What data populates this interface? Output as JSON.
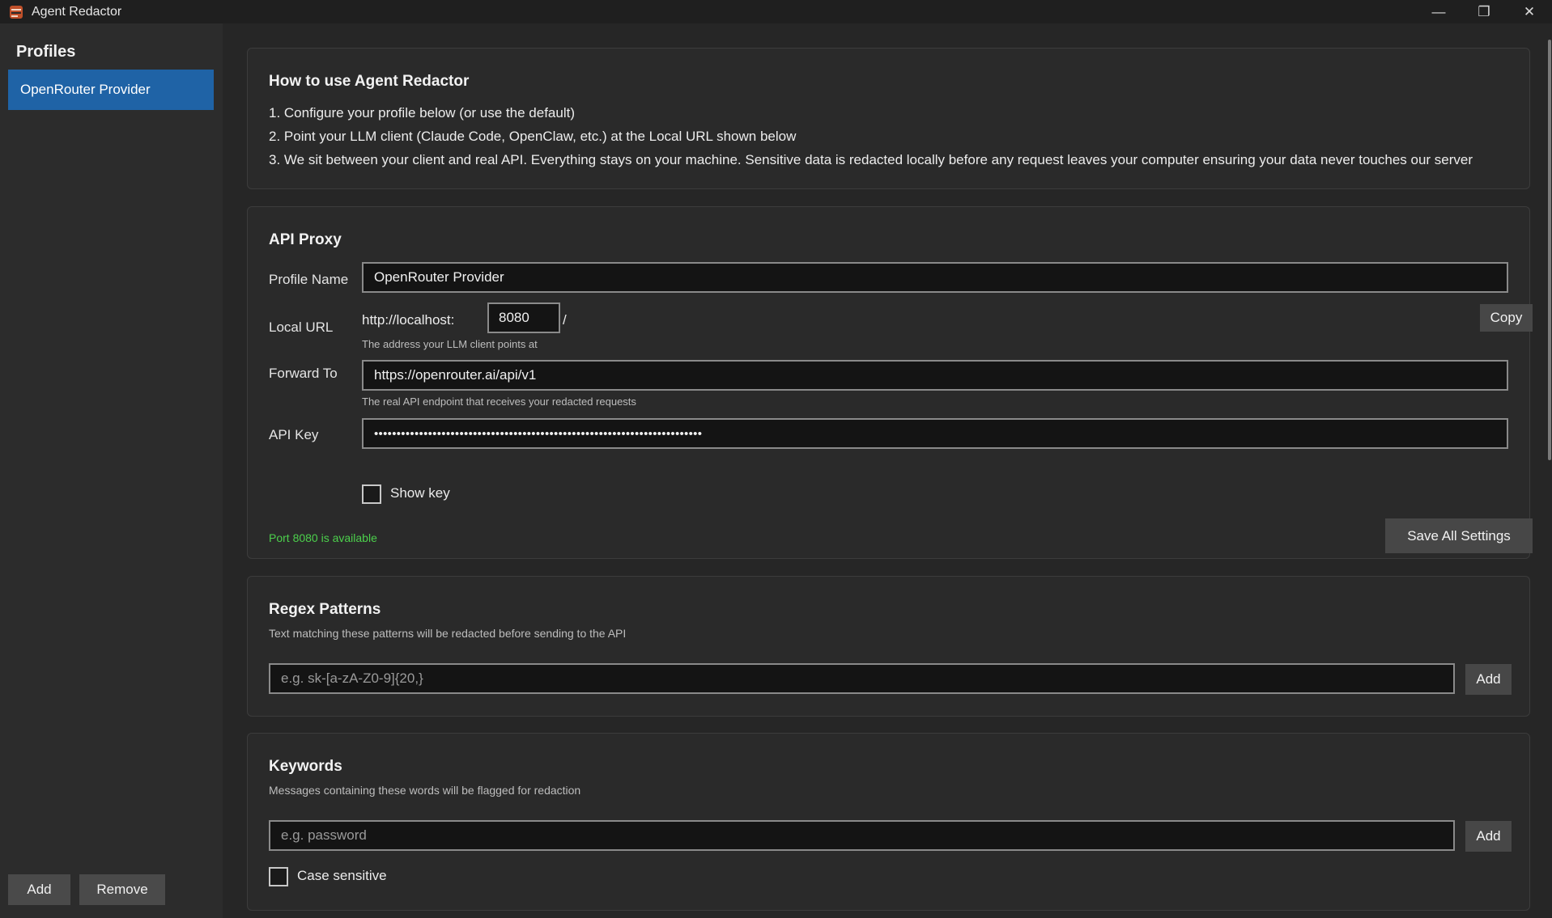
{
  "window": {
    "title": "Agent Redactor",
    "icon": "redactor-app-icon",
    "minimize_glyph": "—",
    "restore_glyph": "❐",
    "close_glyph": "✕"
  },
  "sidebar": {
    "title": "Profiles",
    "items": [
      {
        "label": "OpenRouter Provider",
        "selected": true
      }
    ],
    "add_label": "Add",
    "remove_label": "Remove"
  },
  "howto": {
    "title": "How to use Agent Redactor",
    "steps": [
      "1. Configure your profile below (or use the default)",
      "2. Point your LLM client (Claude Code, OpenClaw, etc.) at the Local URL shown below",
      "3. We sit between your client and real API. Everything stays on your machine. Sensitive data is redacted locally before any request leaves your computer ensuring your data never touches our server"
    ]
  },
  "proxy": {
    "title": "API Proxy",
    "profile_name_label": "Profile Name",
    "profile_name_value": "OpenRouter Provider",
    "local_url_label": "Local URL",
    "local_url_prefix": "http://localhost:",
    "port_value": "8080",
    "local_url_suffix": "/",
    "copy_label": "Copy",
    "local_url_hint": "The address your LLM client points at",
    "forward_label": "Forward To",
    "forward_value": "https://openrouter.ai/api/v1",
    "forward_hint": "The real API endpoint that receives your redacted requests",
    "api_key_label": "API Key",
    "api_key_masked": "•••••••••••••••••••••••••••••••••••••••••••••••••••••••••••••••••••••••••",
    "show_key_label": "Show key",
    "show_key_checked": false,
    "port_status": "Port 8080 is available",
    "save_label": "Save All Settings"
  },
  "regex": {
    "title": "Regex Patterns",
    "description": "Text matching these patterns will be redacted before sending to the API",
    "placeholder": "e.g. sk-[a-zA-Z0-9]{20,}",
    "add_label": "Add"
  },
  "keywords": {
    "title": "Keywords",
    "description": "Messages containing these words will be flagged for redaction",
    "placeholder": "e.g. password",
    "add_label": "Add",
    "case_sensitive_label": "Case sensitive",
    "case_sensitive_checked": false
  },
  "colors": {
    "accent": "#1f63a6",
    "status_ok": "#4cd04c",
    "background": "#262626"
  }
}
